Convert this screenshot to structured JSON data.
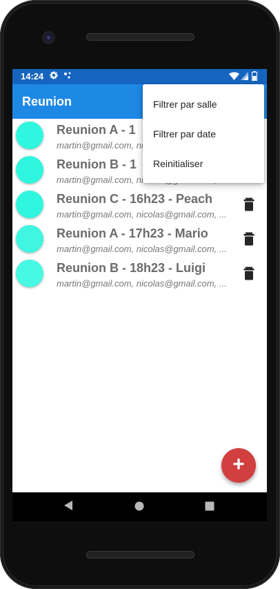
{
  "status": {
    "time": "14:24"
  },
  "appbar": {
    "title": "Reunion"
  },
  "menu": {
    "items": [
      {
        "label": "Filtrer par salle"
      },
      {
        "label": "Filtrer par date"
      },
      {
        "label": "Reinitialiser"
      }
    ]
  },
  "meetings": [
    {
      "title": "Reunion A  -  1",
      "participants": "martin@gmail.com, nicolas@gmail.com, ...",
      "color": "#2ff7df"
    },
    {
      "title": "Reunion B  -  1",
      "participants": "martin@gmail.com, nicolas@gmail.com, ...",
      "color": "#2ff7df"
    },
    {
      "title": "Reunion C  -  16h23  -  Peach",
      "participants": "martin@gmail.com, nicolas@gmail.com, ...",
      "color": "#2ff7df"
    },
    {
      "title": "Reunion A  -  17h23  -  Mario",
      "participants": "martin@gmail.com, nicolas@gmail.com, ...",
      "color": "#3ff6e0"
    },
    {
      "title": "Reunion B  -  18h23  -  Luigi",
      "participants": "martin@gmail.com, nicolas@gmail.com, ...",
      "color": "#47f8e3"
    }
  ],
  "fab": {
    "icon": "plus-icon",
    "label": "+"
  },
  "colors": {
    "statusbar": "#1565c0",
    "appbar": "#1e88e5",
    "fab": "#d23f3f",
    "accent_avatar": "#2ff7df"
  }
}
